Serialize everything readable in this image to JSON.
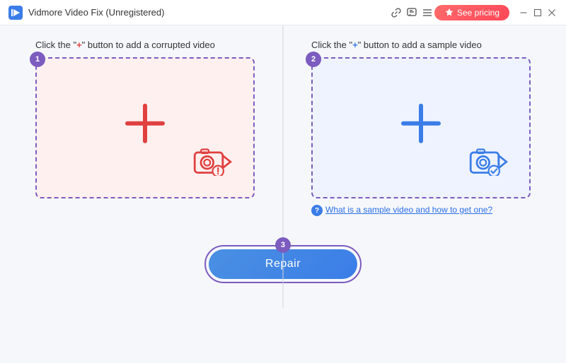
{
  "titleBar": {
    "appName": "Vidmore Video Fix (Unregistered)",
    "seePricingLabel": "See pricing"
  },
  "panels": {
    "leftLabel1": "Click the \"",
    "leftLabelPlus": "+",
    "leftLabel2": "\" button to add a corrupted video",
    "rightLabel1": "Click the \"",
    "rightLabelPlus": "+",
    "rightLabel2": "\" button to add a sample video",
    "sampleLinkText": "What is a sample video and how to get one?"
  },
  "repair": {
    "buttonLabel": "Repair"
  },
  "windowControls": {
    "minimize": "—",
    "maximize": "□",
    "close": "✕"
  }
}
